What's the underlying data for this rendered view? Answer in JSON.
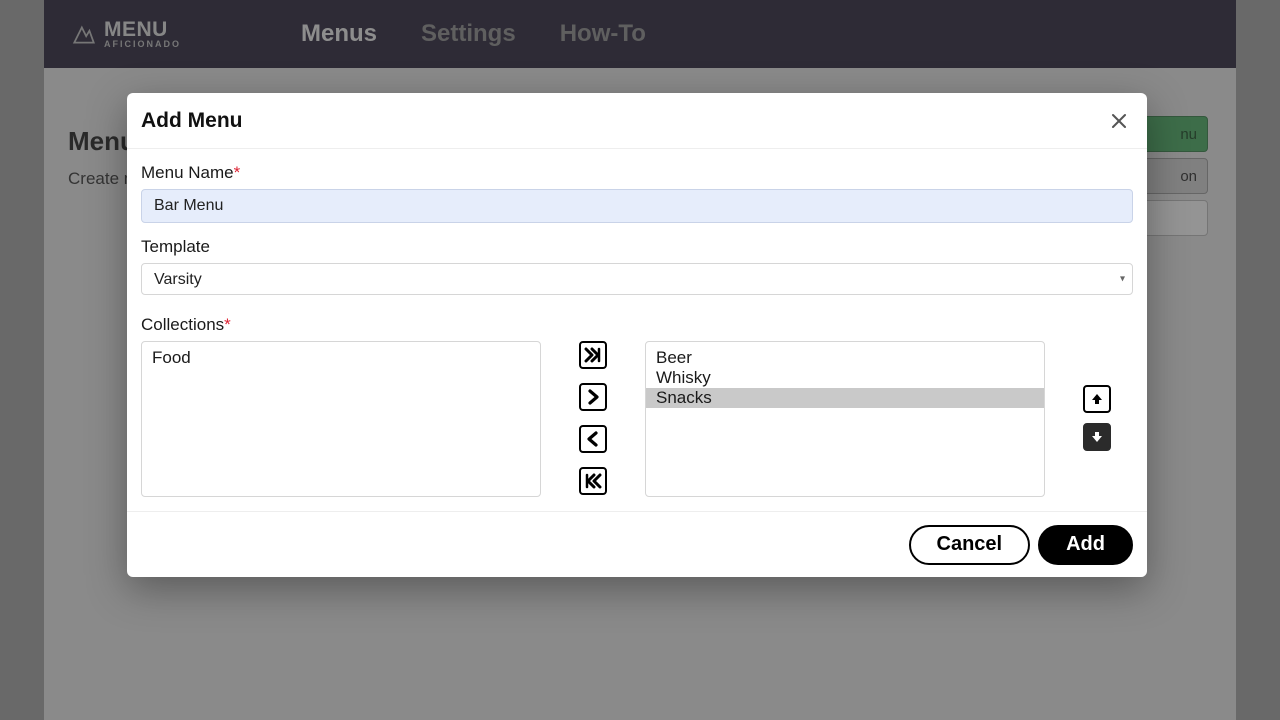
{
  "brand": {
    "line1": "MENU",
    "line2": "AFICIONADO"
  },
  "nav": {
    "items": [
      {
        "label": "Menus",
        "active": true
      },
      {
        "label": "Settings",
        "active": false
      },
      {
        "label": "How-To",
        "active": false
      }
    ]
  },
  "page": {
    "title_fragment": "Menu",
    "subtitle_fragment": "Create m",
    "side_buttons": {
      "b0_suffix": "nu",
      "b1_suffix": "on"
    }
  },
  "modal": {
    "title": "Add Menu",
    "menu_name": {
      "label": "Menu Name",
      "value": "Bar Menu"
    },
    "template": {
      "label": "Template",
      "selected": "Varsity"
    },
    "collections": {
      "label": "Collections",
      "available": [
        "Food"
      ],
      "selected_list": [
        "Beer",
        "Whisky",
        "Snacks"
      ],
      "highlighted": "Snacks"
    },
    "footer": {
      "cancel": "Cancel",
      "add": "Add"
    }
  }
}
